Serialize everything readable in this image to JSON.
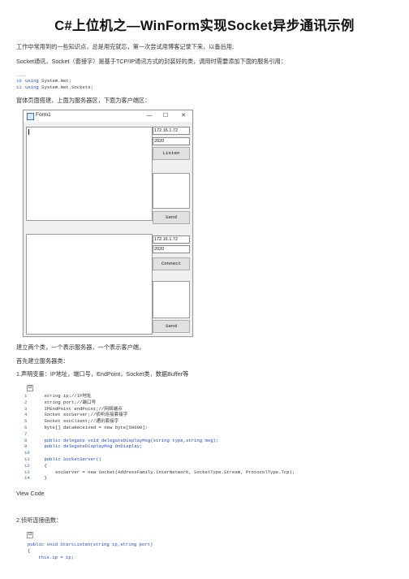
{
  "title": "C#上位机之—WinForm实现Socket异步通讯示例",
  "paragraphs": {
    "p1": "工作中常用到的一些知识点，总是用完就忘，第一次尝试用博客记录下来，以备后用;",
    "p2": "Socket通讯，Socket（套接字）是基于TCP/IP通讯方式的封装好的类，调用时需要添加下面的服务引用：",
    "dots": ".......",
    "p3": "窗体页面搭建，上面为服务器区，下面为客户端区：",
    "p4": "建立两个类，一个表示服务器，一个表示客户端，",
    "p5": "首先建立服务器类：",
    "p6": "1.声明变量：IP地址，端口号，EndPoint，Socket类，数据Buffer等",
    "view_code": "View Code",
    "p7": "2.侦听连接函数："
  },
  "using_code": [
    {
      "ln": "10",
      "kw": "using",
      "rest": " System.Net;"
    },
    {
      "ln": "11",
      "kw": "using",
      "rest": " System.Net.Sockets;"
    }
  ],
  "form": {
    "window_title": "Form1",
    "min_glyph": "—",
    "max_glyph": "☐",
    "close_glyph": "✕",
    "server": {
      "ip": "172.16.1.72",
      "port": "2020",
      "button": "Listen",
      "send": "Send"
    },
    "client": {
      "ip": "172.16.1.72",
      "port": "2020",
      "button": "Connect",
      "send": "Send"
    }
  },
  "code_block": {
    "expand_glyph": "⊟",
    "lines": [
      {
        "ln": "1",
        "text": "string ip;//IP地址"
      },
      {
        "ln": "2",
        "text": "string port;//端口号"
      },
      {
        "ln": "3",
        "text": "IPEndPoint endPoint;//网络端点"
      },
      {
        "ln": "4",
        "text": "Socket socServer;//侦听连接套接字"
      },
      {
        "ln": "5",
        "text": "Socket socClient;//通讯套接字"
      },
      {
        "ln": "6",
        "text": "byte[] dataReceived = new byte[50000];"
      },
      {
        "ln": "7",
        "text": ""
      },
      {
        "ln": "8",
        "text": "public delegate void delegateDisplayMsg(string type,string msg);"
      },
      {
        "ln": "9",
        "text": "public delegateDisplayMsg OnDisplay;"
      },
      {
        "ln": "10",
        "text": ""
      },
      {
        "ln": "11",
        "text": "public SocketServer()"
      },
      {
        "ln": "12",
        "text": "{"
      },
      {
        "ln": "13",
        "text": "    socServer = new Socket(AddressFamily.InterNetwork, SocketType.Stream, ProtocolType.Tcp);"
      },
      {
        "ln": "14",
        "text": "}"
      }
    ]
  },
  "code_block2": {
    "expand_glyph": "⊟",
    "lines": [
      {
        "text": "public void StartListen(string ip,string port)"
      },
      {
        "text": "{"
      },
      {
        "text": "    this.ip = ip;"
      }
    ]
  }
}
